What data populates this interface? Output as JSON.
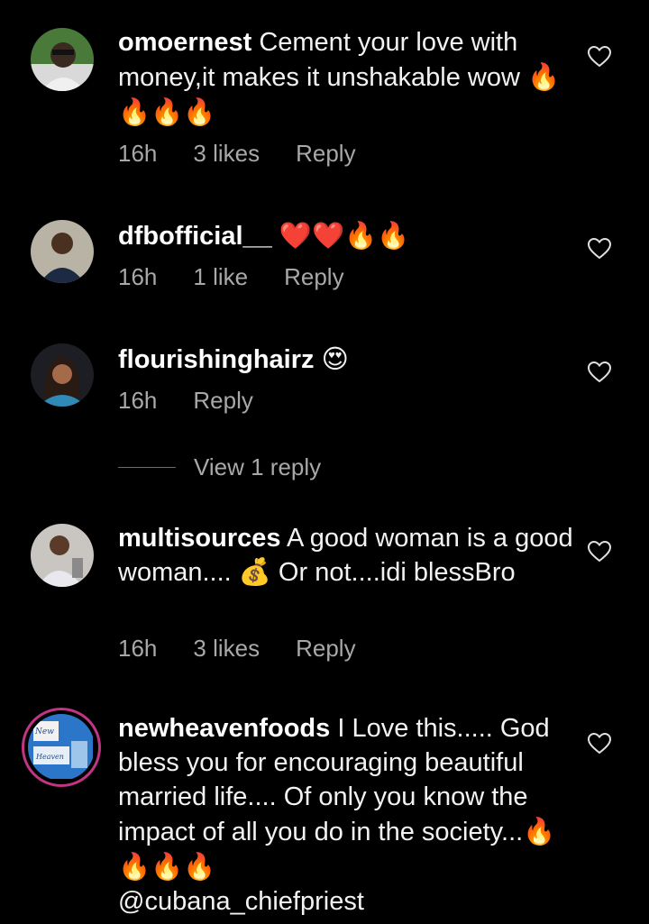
{
  "comments": [
    {
      "username": "omoernest",
      "text": "Cement your love with money,it makes it unshakable wow",
      "emoji": "🔥🔥🔥🔥",
      "time": "16h",
      "likes": "3 likes",
      "reply": "Reply"
    },
    {
      "username": "dfbofficial__",
      "text": "",
      "emoji": "❤️❤️🔥🔥",
      "time": "16h",
      "likes": "1 like",
      "reply": "Reply"
    },
    {
      "username": "flourishinghairz",
      "text": "",
      "emoji": "😍",
      "time": "16h",
      "likes": "",
      "reply": "Reply",
      "view_replies": "View 1 reply"
    },
    {
      "username": "multisources",
      "text": "A good woman is a good woman.... 💰 Or not....idi blessBro",
      "emoji": "",
      "time": "16h",
      "likes": "3 likes",
      "reply": "Reply"
    },
    {
      "username": "newheavenfoods",
      "text": "I Love this..... God bless you for encouraging beautiful married life.... Of only you know the impact of all you do in the society...",
      "emoji": "🔥🔥🔥🔥",
      "mention": "@cubana_chiefpriest"
    }
  ],
  "icons": {
    "like": "heart-outline-icon"
  },
  "colors": {
    "background": "#000000",
    "text": "#f2f2f2",
    "muted": "#a8a8a8",
    "story_ring": "#c13584"
  }
}
